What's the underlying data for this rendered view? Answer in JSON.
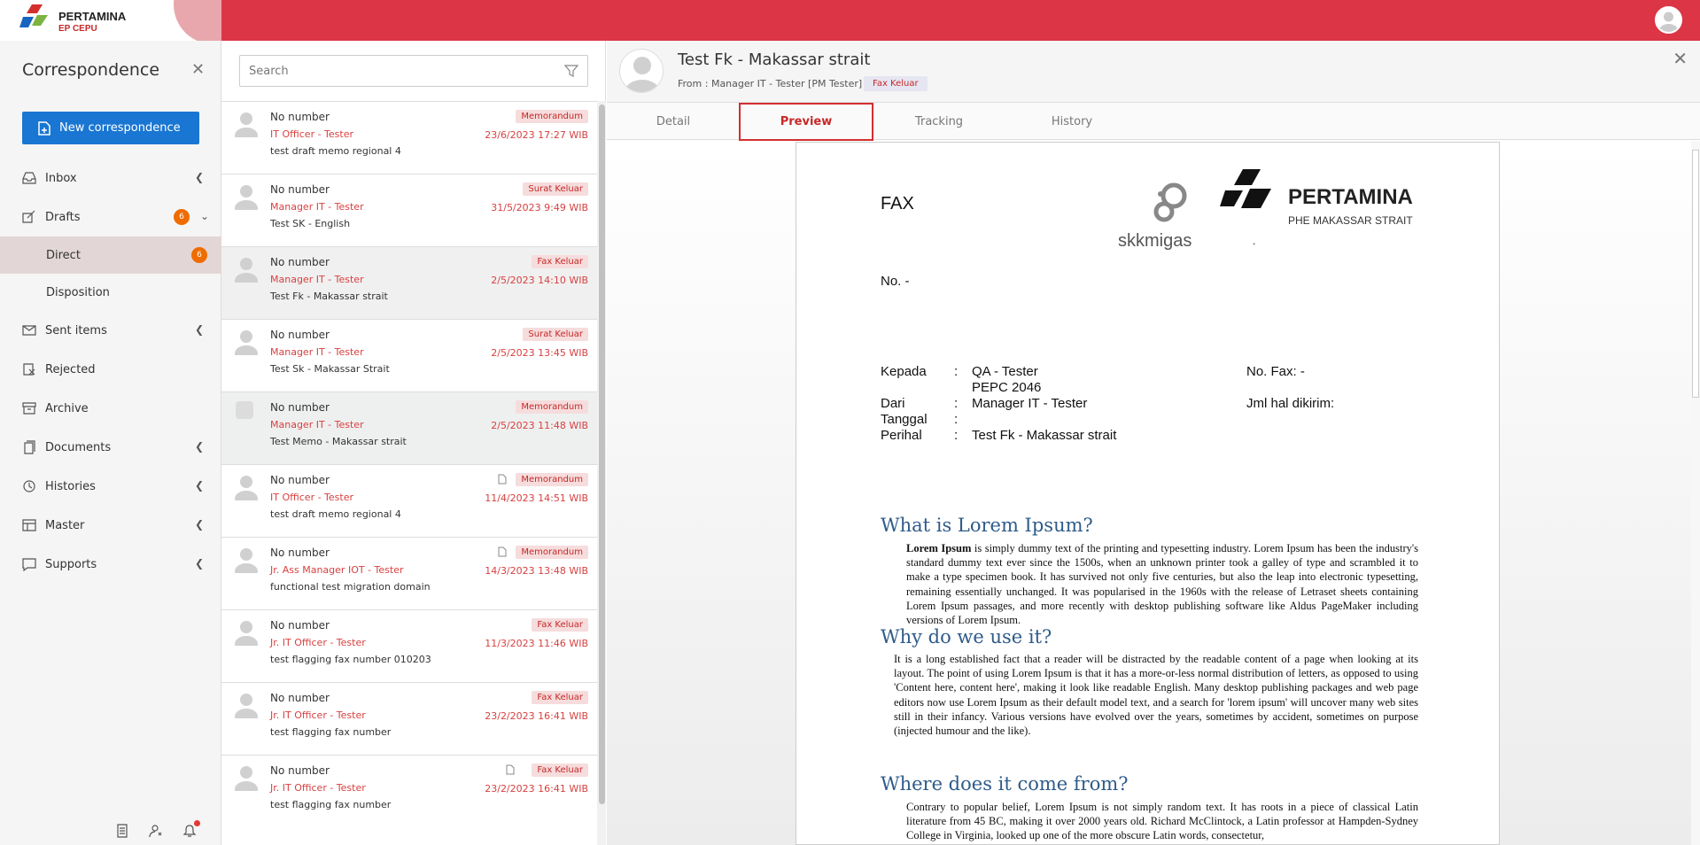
{
  "brand": {
    "name": "PERTAMINA",
    "sub": "EP CEPU"
  },
  "sidebar": {
    "title": "Correspondence",
    "new_button": "New correspondence",
    "items": [
      {
        "label": "Inbox",
        "icon": "inbox-icon"
      },
      {
        "label": "Drafts",
        "icon": "drafts-icon",
        "badge": "6"
      },
      {
        "label": "Direct",
        "badge": "6"
      },
      {
        "label": "Disposition"
      },
      {
        "label": "Sent items",
        "icon": "sent-icon"
      },
      {
        "label": "Rejected",
        "icon": "rejected-icon"
      },
      {
        "label": "Archive",
        "icon": "archive-icon"
      },
      {
        "label": "Documents",
        "icon": "documents-icon"
      },
      {
        "label": "Histories",
        "icon": "history-icon"
      },
      {
        "label": "Master",
        "icon": "master-icon"
      },
      {
        "label": "Supports",
        "icon": "supports-icon"
      }
    ]
  },
  "list": {
    "search_placeholder": "Search",
    "rows": [
      {
        "number": "No number",
        "sender": "IT Officer - Tester",
        "subject": "test draft memo regional 4",
        "tag": "Memorandum",
        "date": "23/6/2023 17:27 WIB"
      },
      {
        "number": "No number",
        "sender": "Manager IT - Tester",
        "subject": "Test SK - English",
        "tag": "Surat Keluar",
        "date": "31/5/2023 9:49 WIB"
      },
      {
        "number": "No number",
        "sender": "Manager IT - Tester",
        "subject": "Test Fk - Makassar strait",
        "tag": "Fax Keluar",
        "date": "2/5/2023 14:10 WIB"
      },
      {
        "number": "No number",
        "sender": "Manager IT - Tester",
        "subject": "Test Sk - Makassar Strait",
        "tag": "Surat Keluar",
        "date": "2/5/2023 13:45 WIB"
      },
      {
        "number": "No number",
        "sender": "Manager IT - Tester",
        "subject": "Test Memo - Makassar strait",
        "tag": "Memorandum",
        "date": "2/5/2023 11:48 WIB"
      },
      {
        "number": "No number",
        "sender": "IT Officer - Tester",
        "subject": "test draft memo regional 4",
        "tag": "Memorandum",
        "date": "11/4/2023 14:51 WIB"
      },
      {
        "number": "No number",
        "sender": "Jr. Ass Manager IOT - Tester",
        "subject": "functional test migration domain",
        "tag": "Memorandum",
        "date": "14/3/2023 13:48 WIB"
      },
      {
        "number": "No number",
        "sender": "Jr. IT Officer - Tester",
        "subject": "test flagging fax number 010203",
        "tag": "Fax Keluar",
        "date": "11/3/2023 11:46 WIB"
      },
      {
        "number": "No number",
        "sender": "Jr. IT Officer - Tester",
        "subject": "test flagging fax number",
        "tag": "Fax Keluar",
        "date": "23/2/2023 16:41 WIB"
      },
      {
        "number": "No number",
        "sender": "Jr. IT Officer - Tester",
        "subject": "test flagging fax number",
        "tag": "Fax Keluar",
        "date": "23/2/2023 16:41 WIB"
      }
    ]
  },
  "detail": {
    "title": "Test Fk - Makassar strait",
    "from": "From : Manager IT - Tester [PM Tester]",
    "tag": "Fax Keluar",
    "tabs": [
      "Detail",
      "Preview",
      "Tracking",
      "History"
    ]
  },
  "doc": {
    "fax": "FAX",
    "skk": "skkmigas",
    "pt_name": "PERTAMINA",
    "pt_sub": "PHE MAKASSAR STRAIT",
    "dot": ".",
    "no": "No. -",
    "kepada_label": "Kepada",
    "kepada_val": "QA - Tester",
    "kepada_val2": "PEPC 2046",
    "dari_label": "Dari",
    "dari_val": "Manager IT - Tester",
    "tanggal_label": "Tanggal",
    "perihal_label": "Perihal",
    "perihal_val": "Test Fk - Makassar strait",
    "colon": ":",
    "nofax": "No. Fax: -",
    "jml": "Jml hal dikirim:",
    "h1": "What is Lorem Ipsum?",
    "p1_bold": "Lorem Ipsum",
    "p1": " is simply dummy text of the printing and typesetting industry. Lorem Ipsum has been the industry's standard dummy text ever since the 1500s, when an unknown printer took a galley of type and scrambled it to make a type specimen book. It has survived not only five centuries, but also the leap into electronic typesetting, remaining essentially unchanged. It was popularised in the 1960s with the release of Letraset sheets containing Lorem Ipsum passages, and more recently with desktop publishing software like Aldus PageMaker including versions of Lorem Ipsum.",
    "h2": "Why do we use it?",
    "p2": "It is a long established fact that a reader will be distracted by the readable content of a page when looking at its layout. The point of using Lorem Ipsum is that it has a more-or-less normal distribution of letters, as opposed to using 'Content here, content here', making it look like readable English. Many desktop publishing packages and web page editors now use Lorem Ipsum as their default model text, and a search for 'lorem ipsum' will uncover many web sites still in their infancy. Various versions have evolved over the years, sometimes by accident, sometimes on purpose (injected humour and the like).",
    "h3": "Where does it come from?",
    "p3": "Contrary to popular belief, Lorem Ipsum is not simply random text. It has roots in a piece of classical Latin literature from 45 BC, making it over 2000 years old. Richard McClintock, a Latin professor at Hampden-Sydney College in Virginia, looked up one of the more obscure Latin words, consectetur,"
  }
}
